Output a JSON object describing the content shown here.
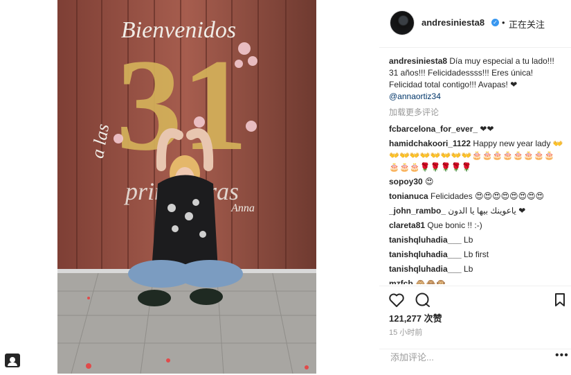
{
  "post": {
    "username": "andresiniesta8",
    "follow_status": "正在关注",
    "separator": "•",
    "verified_mark": "✓"
  },
  "caption": {
    "username": "andresiniesta8",
    "text": "Día muy especial a tu lado!!! 31 años!!! Felicidadessss!!! Eres única! Felicidad total contigo!!! Avapas! ❤",
    "mention": "@annaortiz34"
  },
  "load_more": "加载更多评论",
  "comments": [
    {
      "user": "fcbarcelona_for_ever_",
      "text": "❤❤"
    },
    {
      "user": "hamidchakoori_1122",
      "text": "Happy new year lady 👐👐👐👐👐👐👐👐👐🎂🎂🎂🎂🎂🎂🎂🎂🎂🎂🎂🌹🌹🌹🌹🌹"
    },
    {
      "user": "sopoy30",
      "text": "😍"
    },
    {
      "user": "tonianuca",
      "text": "Felicidades 😍😍😍😍😍😍😍😍"
    },
    {
      "user": "_john_rambo_",
      "text": "ياعوينك بيها يا الدون ❤"
    },
    {
      "user": "clareta81",
      "text": "Que bonic !! :-)"
    },
    {
      "user": "tanishqluhadia___",
      "text": "Lb"
    },
    {
      "user": "tanishqluhadia___",
      "text": "Lb first"
    },
    {
      "user": "tanishqluhadia___",
      "text": "Lb"
    },
    {
      "user": "mzfcb",
      "text": "🙊🙈🙉"
    }
  ],
  "likes": {
    "count": "121,277",
    "label": "次赞"
  },
  "time_ago": "15 小时前",
  "add_comment_placeholder": "添加评论...",
  "more_options": "•••",
  "photo": {
    "banner_top": "Bienvenidos",
    "banner_number": "31",
    "banner_side": "a las",
    "banner_bottom": "primaveras",
    "banner_name": "Anna"
  }
}
